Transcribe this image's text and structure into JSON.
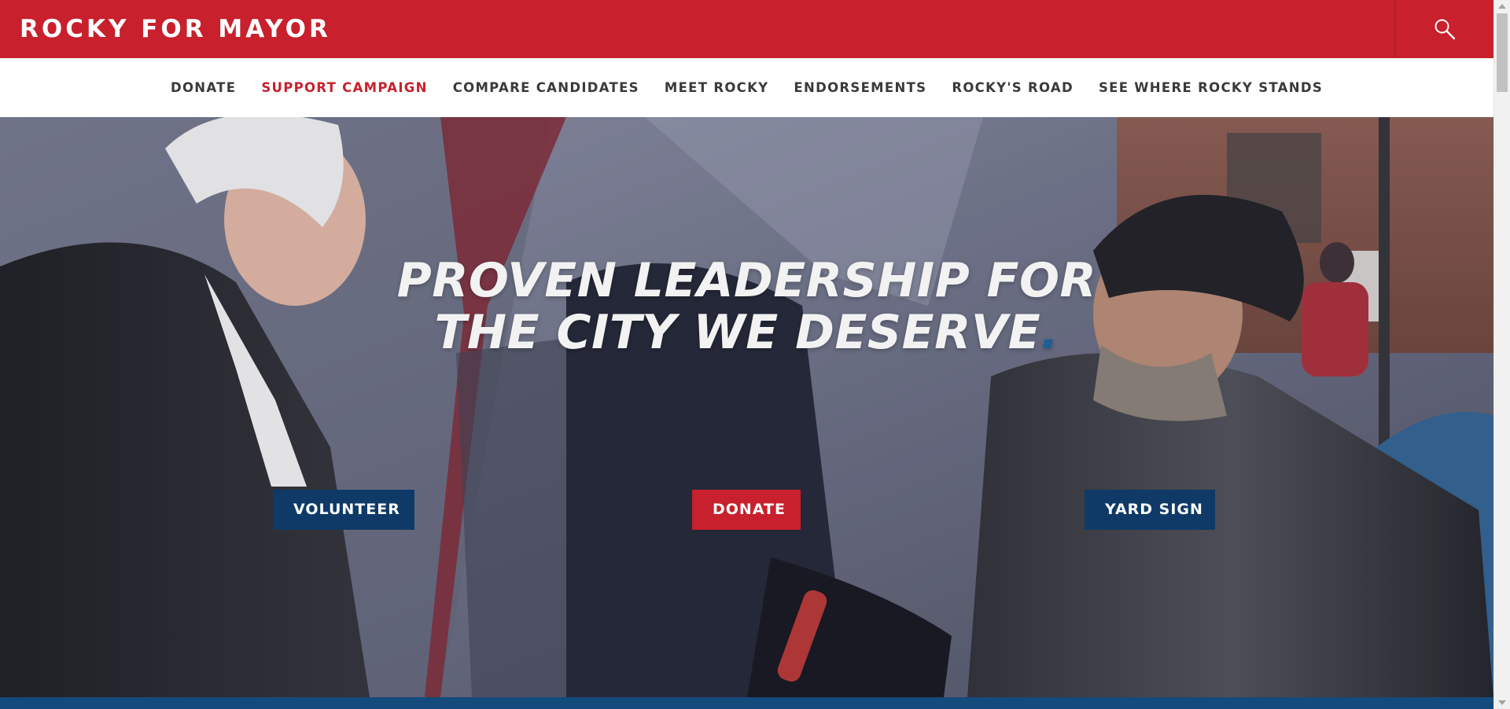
{
  "header": {
    "brand": "ROCKY FOR MAYOR",
    "search_icon": "search-icon",
    "brand_color": "#c8202c"
  },
  "nav": {
    "items": [
      {
        "label": "DONATE",
        "active": false
      },
      {
        "label": "SUPPORT CAMPAIGN",
        "active": true
      },
      {
        "label": "COMPARE CANDIDATES",
        "active": false
      },
      {
        "label": "MEET ROCKY",
        "active": false
      },
      {
        "label": "ENDORSEMENTS",
        "active": false
      },
      {
        "label": "ROCKY'S ROAD",
        "active": false
      },
      {
        "label": "SEE WHERE ROCKY STANDS",
        "active": false
      }
    ]
  },
  "hero": {
    "headline_line1": "PROVEN LEADERSHIP FOR",
    "headline_line2": "THE CITY WE DESERVE",
    "headline_dot": ".",
    "buttons": {
      "volunteer": "VOLUNTEER",
      "donate": "DONATE",
      "yard_sign": "YARD SIGN"
    },
    "colors": {
      "navy": "#0f3a67",
      "red": "#c8202c",
      "accent_blue": "#1f5e93",
      "bottom_strip": "#124b7c"
    }
  }
}
